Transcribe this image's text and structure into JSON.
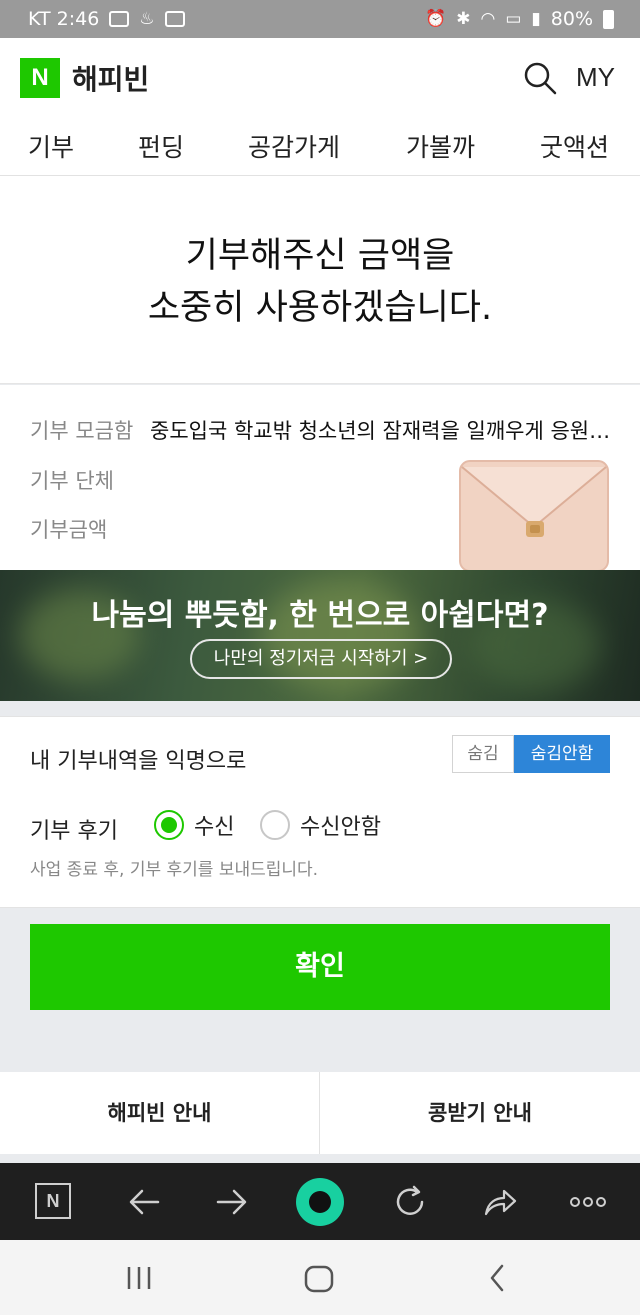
{
  "status_bar": {
    "carrier_time": "KT 2:46",
    "battery": "80%"
  },
  "header": {
    "logo": "N",
    "brand": "해피빈",
    "my": "MY"
  },
  "tabs": [
    {
      "label": "기부",
      "active": true
    },
    {
      "label": "펀딩"
    },
    {
      "label": "공감가게"
    },
    {
      "label": "가볼까"
    },
    {
      "label": "굿액션"
    }
  ],
  "thanks": {
    "line1": "기부해주신 금액을",
    "line2": "소중히 사용하겠습니다."
  },
  "info": {
    "campaign_label": "기부 모금함",
    "campaign_value": "중도입국 학교밖 청소년의 잠재력을 일깨우게 응원해주세요",
    "org_label": "기부 단체",
    "amount_label": "기부금액"
  },
  "banner": {
    "title": "나눔의 뿌듯함, 한 번으로 아쉽다면?",
    "button": "나만의 정기저금 시작하기 >"
  },
  "options": {
    "anonymous_label": "내 기부내역을 익명으로",
    "hide": "숨김",
    "no_hide": "숨김안함",
    "review_label": "기부 후기",
    "receive": "수신",
    "not_receive": "수신안함",
    "review_note": "사업 종료 후, 기부 후기를 보내드립니다."
  },
  "confirm_button": "확인",
  "footer_links": {
    "happybean_guide": "해피빈 안내",
    "bean_guide": "콩받기 안내"
  },
  "colors": {
    "naver_green": "#1ec800",
    "toggle_blue": "#2d85d8"
  }
}
